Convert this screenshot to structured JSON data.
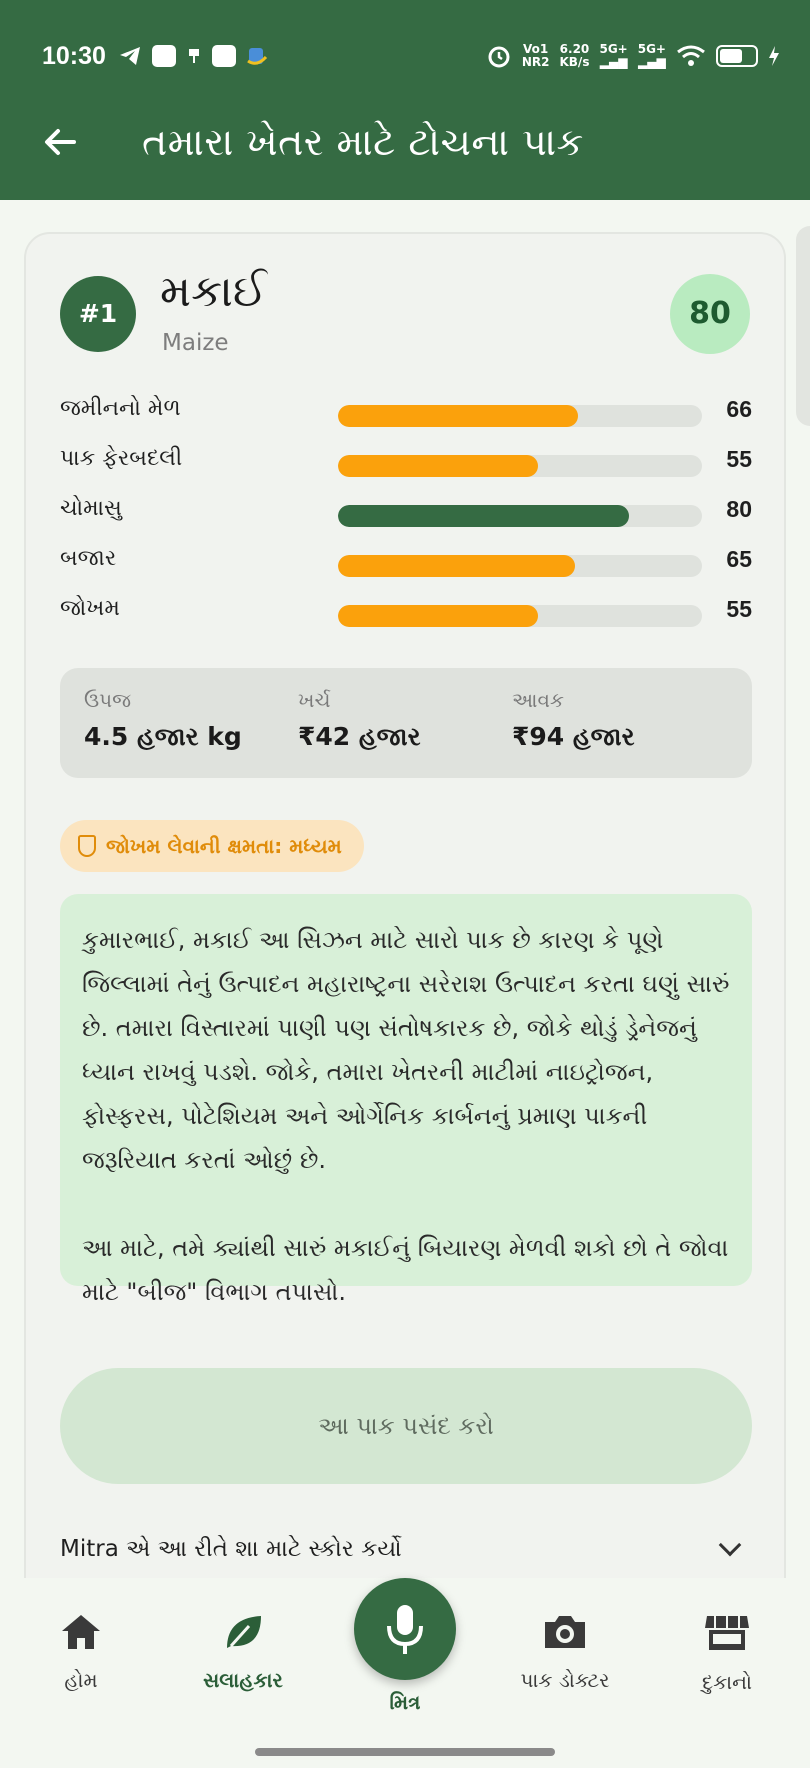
{
  "status_bar": {
    "time": "10:30",
    "network_1": "Vo1",
    "network_2": "NR2",
    "speed_value": "6.20",
    "speed_unit": "KB/s",
    "signal_1": "5G+",
    "signal_2": "5G+"
  },
  "appbar": {
    "title": "તમારા ખેતર માટે ટોચના પાક"
  },
  "crop": {
    "rank": "#1",
    "name": "મકાઈ",
    "name_en": "Maize",
    "score": "80",
    "metrics": [
      {
        "label": "જમીનનો મેળ",
        "value": 66,
        "color": "#fba10c"
      },
      {
        "label": "પાક ફેરબદલી",
        "value": 55,
        "color": "#fba10c"
      },
      {
        "label": "ચોમાસુ",
        "value": 80,
        "color": "#356b43"
      },
      {
        "label": "બજાર",
        "value": 65,
        "color": "#fba10c"
      },
      {
        "label": "જોખમ",
        "value": 55,
        "color": "#fba10c"
      }
    ],
    "stats": {
      "yield_label": "ઉપજ",
      "yield_value": "4.5 હજાર kg",
      "cost_label": "ખર્ચ",
      "cost_value": "₹42 હજાર",
      "income_label": "આવક",
      "income_value": "₹94 હજાર"
    },
    "risk_badge": "જોખમ લેવાની ક્ષમતા: મધ્યમ",
    "advice_p1": "કુમારભાઈ, મકાઈ આ સિઝન માટે સારો પાક છે કારણ કે પૂણે જિલ્લામાં તેનું ઉત્પાદન મહારાષ્ટ્રના સરેરાશ ઉત્પાદન કરતા ઘણું સારું છે. તમારા વિસ્તારમાં પાણી પણ સંતોષકારક છે, જોકે થોડું ડ્રેનેજનું ધ્યાન રાખવું પડશે. જોકે, તમારા ખેતરની માટીમાં નાઇટ્રોજન, ફોસ્ફરસ, પોટેશિયમ અને ઓર્ગેનિક કાર્બનનું પ્રમાણ પાકની જરૂરિયાત કરતાં ઓછું છે.",
    "advice_p2": "આ માટે, તમે ક્યાંથી સારું મકાઈનું બિયારણ મેળવી શકો છો તે જોવા માટે \"બીજ\" વિભાગ તપાસો.",
    "choose_button": "આ પાક પસંદ કરો",
    "why_text": "Mitra એ આ રીતે શા માટે સ્કોર કર્યો"
  },
  "bottom_nav": {
    "home": "હોમ",
    "advisor": "સલાહકાર",
    "mitra": "મિત્ર",
    "crop_doctor": "પાક ડોક્ટર",
    "shops": "દુકાનો"
  }
}
